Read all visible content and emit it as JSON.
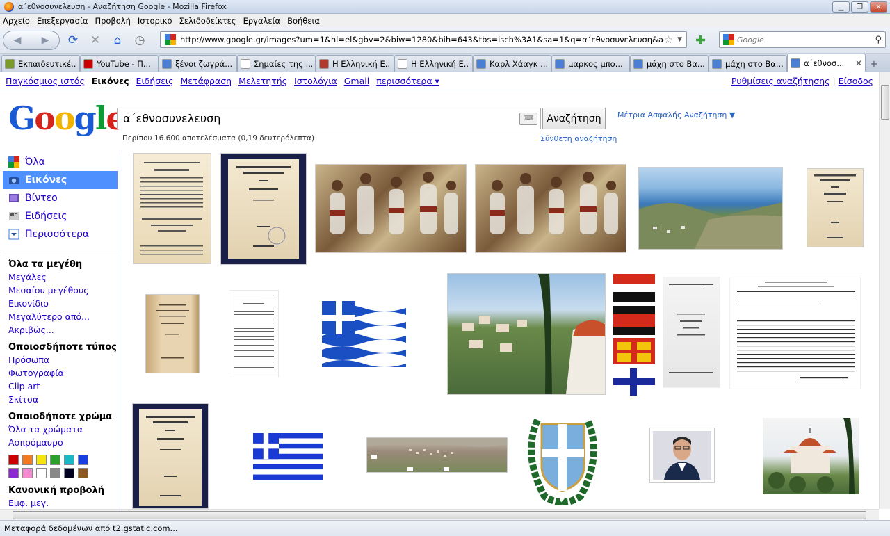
{
  "window": {
    "title": "α΄εθνοσυνελευση - Αναζήτηση Google - Mozilla Firefox"
  },
  "menu": [
    "Αρχείο",
    "Επεξεργασία",
    "Προβολή",
    "Ιστορικό",
    "Σελιδοδείκτες",
    "Εργαλεία",
    "Βοήθεια"
  ],
  "address": {
    "url": "http://www.google.gr/images?um=1&hl=el&gbv=2&biw=1280&bih=643&tbs=isch%3A1&sa=1&q=α΄εθνοσυνελευση&aq=f&aq"
  },
  "search_box": {
    "placeholder": "Google"
  },
  "tabs": [
    {
      "label": "Εκπαιδευτικέ...",
      "fav": "#7a9a2a"
    },
    {
      "label": "YouTube - Π...",
      "fav": "#cc0000"
    },
    {
      "label": "ξένοι ζωγρά...",
      "fav": "#4a7fd4"
    },
    {
      "label": "Σημαίες της ...",
      "fav": "#ffffff"
    },
    {
      "label": "Η Ελληνική Ε...",
      "fav": "#b03a2e"
    },
    {
      "label": "Η Ελληνική Ε...",
      "fav": "#ffffff"
    },
    {
      "label": "Καρλ Χάαγκ ...",
      "fav": "#4a7fd4"
    },
    {
      "label": "μαρκος μπο...",
      "fav": "#4a7fd4"
    },
    {
      "label": "μάχη στο Βα...",
      "fav": "#4a7fd4"
    },
    {
      "label": "μάχη στο Βα...",
      "fav": "#4a7fd4"
    },
    {
      "label": "α΄εθνοσ...",
      "fav": "#4a7fd4",
      "active": true
    }
  ],
  "gbar": {
    "links": [
      "Παγκόσμιος ιστός",
      "Εικόνες",
      "Ειδήσεις",
      "Μετάφραση",
      "Μελετητής",
      "Ιστολόγια",
      "Gmail",
      "περισσότερα ▾"
    ],
    "settings": "Ρυθμίσεις αναζήτησης",
    "sep": "|",
    "signin": "Είσοδος"
  },
  "search": {
    "query": "α΄εθνοσυνελευση",
    "button": "Αναζήτηση",
    "safe": "Μέτρια Ασφαλής Αναζήτηση ▼",
    "count": "Περίπου 16.600 αποτελέσματα (0,19 δευτερόλεπτα)",
    "advanced": "Σύνθετη αναζήτηση"
  },
  "leftnav": {
    "items": [
      {
        "label": "Όλα",
        "icon": "#3b7de0"
      },
      {
        "label": "Εικόνες",
        "icon": "#3b7de0",
        "selected": true
      },
      {
        "label": "Βίντεο",
        "icon": "#6b4bb8"
      },
      {
        "label": "Ειδήσεις",
        "icon": "#777777"
      },
      {
        "label": "Περισσότερα",
        "icon": "#3b7de0"
      }
    ],
    "size_head": "Όλα τα μεγέθη",
    "sizes": [
      "Μεγάλες",
      "Μεσαίου μεγέθους",
      "Εικονίδιο",
      "Μεγαλύτερο από...",
      "Ακριβώς..."
    ],
    "type_head": "Οποιοσδήποτε τύπος",
    "types": [
      "Πρόσωπα",
      "Φωτογραφία",
      "Clip art",
      "Σκίτσα"
    ],
    "color_head": "Οποιοδήποτε χρώμα",
    "colors_links": [
      "Όλα τα χρώματα",
      "Ασπρόμαυρο"
    ],
    "swatches": [
      "#cc0000",
      "#f47a20",
      "#f5e50c",
      "#2ca02c",
      "#1ab8c6",
      "#1a3fe0",
      "#8a2ad0",
      "#f48ad0",
      "#ffffff",
      "#888888",
      "#000022",
      "#8a5a20"
    ],
    "view_head": "Κανονική προβολή",
    "view_link": "Εμφ. μεγ."
  },
  "status": "Μεταφορά δεδομένων από t2.gstatic.com..."
}
